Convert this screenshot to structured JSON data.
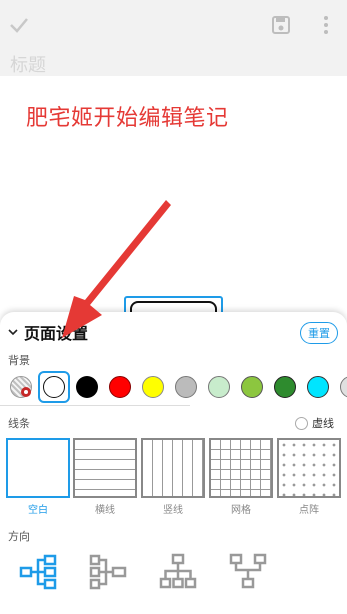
{
  "topbar": {
    "confirm_icon": "check-icon",
    "save_icon": "save-icon",
    "more_icon": "more-vertical-icon"
  },
  "title": {
    "placeholder": "标题"
  },
  "canvas": {
    "annotation": "肥宅姬开始编辑笔记"
  },
  "sheet": {
    "title": "页面设置",
    "reset_label": "重置",
    "background_label": "背景",
    "background_colors": [
      "#c0c0c0",
      "#ffffff",
      "#000000",
      "#ff0000",
      "#ffff00",
      "#bbbbbb",
      "#c8eccc",
      "#8cc63f",
      "#2e8b2e",
      "#00e5ff",
      "#e0e0e0"
    ],
    "selected_background": "#ffffff",
    "lines_label": "线条",
    "dashed_label": "虚线",
    "patterns": [
      {
        "label": "空白"
      },
      {
        "label": "横线"
      },
      {
        "label": "竖线"
      },
      {
        "label": "网格"
      },
      {
        "label": "点阵"
      }
    ],
    "direction_label": "方向",
    "directions": [
      "mindmap-right-icon",
      "mindmap-tree-icon",
      "org-chart-down-icon",
      "org-chart-tree-icon"
    ],
    "accent": "#1e9be8"
  }
}
